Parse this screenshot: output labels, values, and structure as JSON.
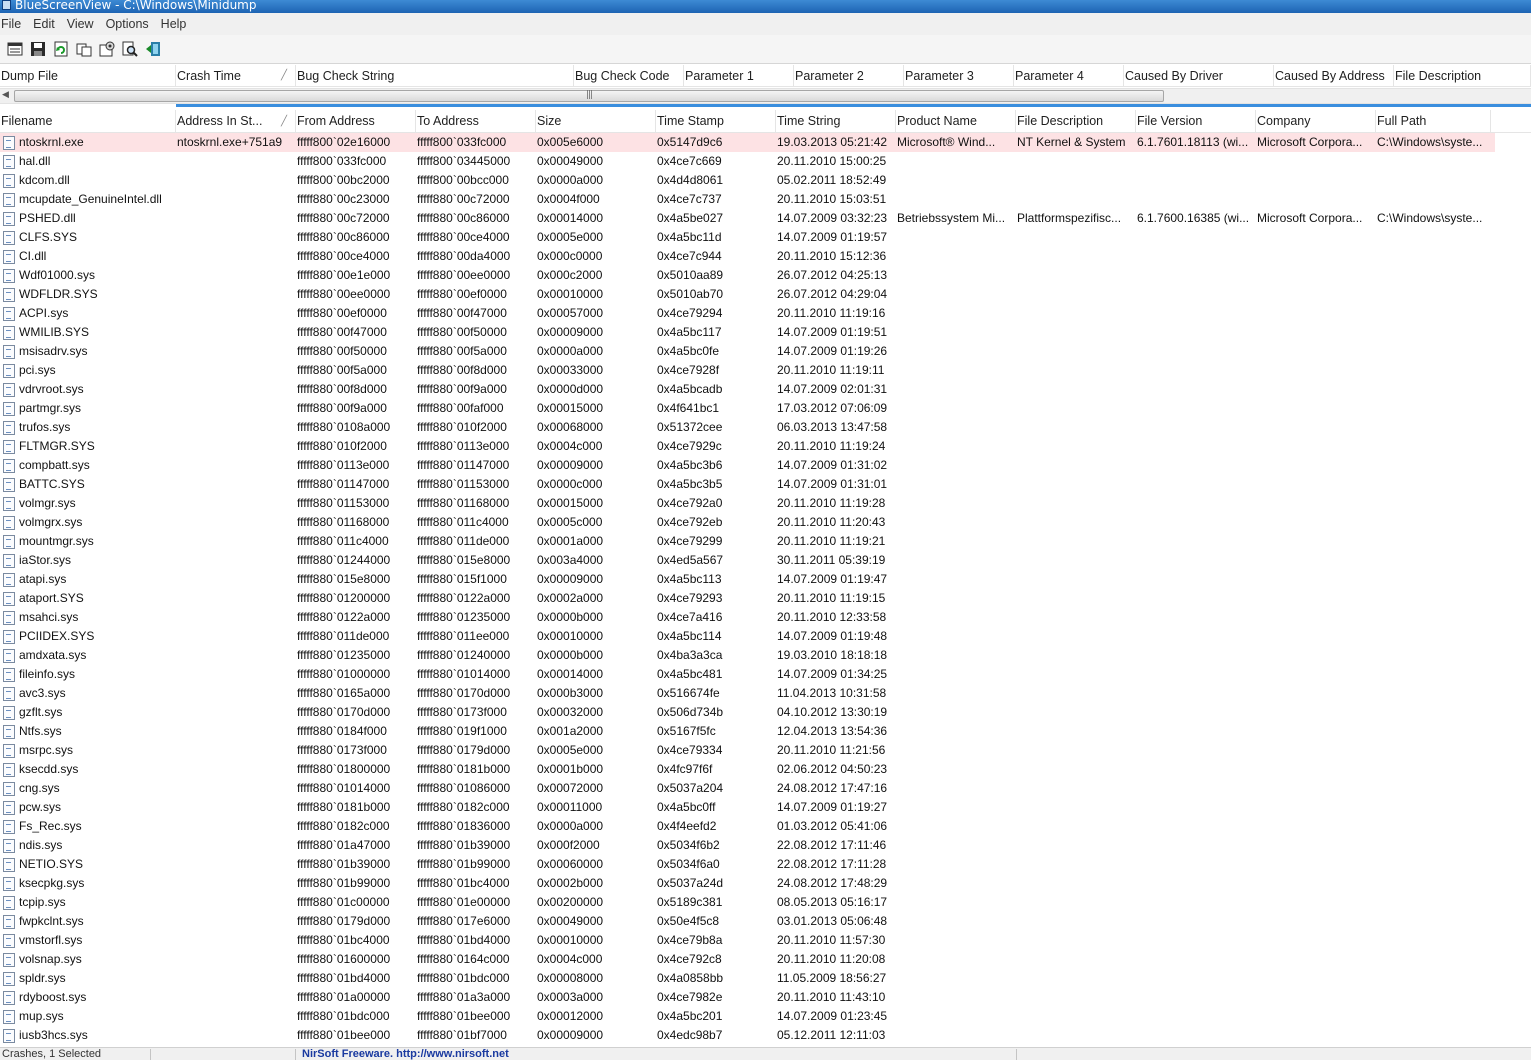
{
  "window": {
    "title": "BlueScreenView  -  C:\\Windows\\Minidump"
  },
  "menu": [
    "File",
    "Edit",
    "View",
    "Options",
    "Help"
  ],
  "toolbar": {
    "buttons": [
      "properties-icon",
      "save-icon",
      "refresh-icon",
      "copy-icon",
      "options-icon",
      "find-icon",
      "exit-icon"
    ]
  },
  "upper_table": {
    "columns": [
      "Dump File",
      "Crash Time",
      "Bug Check String",
      "Bug Check Code",
      "Parameter 1",
      "Parameter 2",
      "Parameter 3",
      "Parameter 4",
      "Caused By Driver",
      "Caused By Address",
      "File Description"
    ],
    "sorted_column": "Crash Time"
  },
  "lower_table": {
    "columns": [
      "Filename",
      "Address In St...",
      "From Address",
      "To Address",
      "Size",
      "Time Stamp",
      "Time String",
      "Product Name",
      "File Description",
      "File Version",
      "Company",
      "Full Path"
    ],
    "sorted_column": "Address In St...",
    "rows": [
      [
        "ntoskrnl.exe",
        "ntoskrnl.exe+751a9",
        "fffff800`02e16000",
        "fffff800`033fc000",
        "0x005e6000",
        "0x5147d9c6",
        "19.03.2013 05:21:42",
        "Microsoft® Wind...",
        "NT Kernel & System",
        "6.1.7601.18113 (wi...",
        "Microsoft Corpora...",
        "C:\\Windows\\syste..."
      ],
      [
        "hal.dll",
        "",
        "fffff800`033fc000",
        "fffff800`03445000",
        "0x00049000",
        "0x4ce7c669",
        "20.11.2010 15:00:25",
        "",
        "",
        "",
        "",
        ""
      ],
      [
        "kdcom.dll",
        "",
        "fffff800`00bc2000",
        "fffff800`00bcc000",
        "0x0000a000",
        "0x4d4d8061",
        "05.02.2011 18:52:49",
        "",
        "",
        "",
        "",
        ""
      ],
      [
        "mcupdate_GenuineIntel.dll",
        "",
        "fffff880`00c23000",
        "fffff880`00c72000",
        "0x0004f000",
        "0x4ce7c737",
        "20.11.2010 15:03:51",
        "",
        "",
        "",
        "",
        ""
      ],
      [
        "PSHED.dll",
        "",
        "fffff880`00c72000",
        "fffff880`00c86000",
        "0x00014000",
        "0x4a5be027",
        "14.07.2009 03:32:23",
        "Betriebssystem Mi...",
        "Plattformspezifisc...",
        "6.1.7600.16385 (wi...",
        "Microsoft Corpora...",
        "C:\\Windows\\syste..."
      ],
      [
        "CLFS.SYS",
        "",
        "fffff880`00c86000",
        "fffff880`00ce4000",
        "0x0005e000",
        "0x4a5bc11d",
        "14.07.2009 01:19:57",
        "",
        "",
        "",
        "",
        ""
      ],
      [
        "CI.dll",
        "",
        "fffff880`00ce4000",
        "fffff880`00da4000",
        "0x000c0000",
        "0x4ce7c944",
        "20.11.2010 15:12:36",
        "",
        "",
        "",
        "",
        ""
      ],
      [
        "Wdf01000.sys",
        "",
        "fffff880`00e1e000",
        "fffff880`00ee0000",
        "0x000c2000",
        "0x5010aa89",
        "26.07.2012 04:25:13",
        "",
        "",
        "",
        "",
        ""
      ],
      [
        "WDFLDR.SYS",
        "",
        "fffff880`00ee0000",
        "fffff880`00ef0000",
        "0x00010000",
        "0x5010ab70",
        "26.07.2012 04:29:04",
        "",
        "",
        "",
        "",
        ""
      ],
      [
        "ACPI.sys",
        "",
        "fffff880`00ef0000",
        "fffff880`00f47000",
        "0x00057000",
        "0x4ce79294",
        "20.11.2010 11:19:16",
        "",
        "",
        "",
        "",
        ""
      ],
      [
        "WMILIB.SYS",
        "",
        "fffff880`00f47000",
        "fffff880`00f50000",
        "0x00009000",
        "0x4a5bc117",
        "14.07.2009 01:19:51",
        "",
        "",
        "",
        "",
        ""
      ],
      [
        "msisadrv.sys",
        "",
        "fffff880`00f50000",
        "fffff880`00f5a000",
        "0x0000a000",
        "0x4a5bc0fe",
        "14.07.2009 01:19:26",
        "",
        "",
        "",
        "",
        ""
      ],
      [
        "pci.sys",
        "",
        "fffff880`00f5a000",
        "fffff880`00f8d000",
        "0x00033000",
        "0x4ce7928f",
        "20.11.2010 11:19:11",
        "",
        "",
        "",
        "",
        ""
      ],
      [
        "vdrvroot.sys",
        "",
        "fffff880`00f8d000",
        "fffff880`00f9a000",
        "0x0000d000",
        "0x4a5bcadb",
        "14.07.2009 02:01:31",
        "",
        "",
        "",
        "",
        ""
      ],
      [
        "partmgr.sys",
        "",
        "fffff880`00f9a000",
        "fffff880`00faf000",
        "0x00015000",
        "0x4f641bc1",
        "17.03.2012 07:06:09",
        "",
        "",
        "",
        "",
        ""
      ],
      [
        "trufos.sys",
        "",
        "fffff880`0108a000",
        "fffff880`010f2000",
        "0x00068000",
        "0x51372cee",
        "06.03.2013 13:47:58",
        "",
        "",
        "",
        "",
        ""
      ],
      [
        "FLTMGR.SYS",
        "",
        "fffff880`010f2000",
        "fffff880`0113e000",
        "0x0004c000",
        "0x4ce7929c",
        "20.11.2010 11:19:24",
        "",
        "",
        "",
        "",
        ""
      ],
      [
        "compbatt.sys",
        "",
        "fffff880`0113e000",
        "fffff880`01147000",
        "0x00009000",
        "0x4a5bc3b6",
        "14.07.2009 01:31:02",
        "",
        "",
        "",
        "",
        ""
      ],
      [
        "BATTC.SYS",
        "",
        "fffff880`01147000",
        "fffff880`01153000",
        "0x0000c000",
        "0x4a5bc3b5",
        "14.07.2009 01:31:01",
        "",
        "",
        "",
        "",
        ""
      ],
      [
        "volmgr.sys",
        "",
        "fffff880`01153000",
        "fffff880`01168000",
        "0x00015000",
        "0x4ce792a0",
        "20.11.2010 11:19:28",
        "",
        "",
        "",
        "",
        ""
      ],
      [
        "volmgrx.sys",
        "",
        "fffff880`01168000",
        "fffff880`011c4000",
        "0x0005c000",
        "0x4ce792eb",
        "20.11.2010 11:20:43",
        "",
        "",
        "",
        "",
        ""
      ],
      [
        "mountmgr.sys",
        "",
        "fffff880`011c4000",
        "fffff880`011de000",
        "0x0001a000",
        "0x4ce79299",
        "20.11.2010 11:19:21",
        "",
        "",
        "",
        "",
        ""
      ],
      [
        "iaStor.sys",
        "",
        "fffff880`01244000",
        "fffff880`015e8000",
        "0x003a4000",
        "0x4ed5a567",
        "30.11.2011 05:39:19",
        "",
        "",
        "",
        "",
        ""
      ],
      [
        "atapi.sys",
        "",
        "fffff880`015e8000",
        "fffff880`015f1000",
        "0x00009000",
        "0x4a5bc113",
        "14.07.2009 01:19:47",
        "",
        "",
        "",
        "",
        ""
      ],
      [
        "ataport.SYS",
        "",
        "fffff880`01200000",
        "fffff880`0122a000",
        "0x0002a000",
        "0x4ce79293",
        "20.11.2010 11:19:15",
        "",
        "",
        "",
        "",
        ""
      ],
      [
        "msahci.sys",
        "",
        "fffff880`0122a000",
        "fffff880`01235000",
        "0x0000b000",
        "0x4ce7a416",
        "20.11.2010 12:33:58",
        "",
        "",
        "",
        "",
        ""
      ],
      [
        "PCIIDEX.SYS",
        "",
        "fffff880`011de000",
        "fffff880`011ee000",
        "0x00010000",
        "0x4a5bc114",
        "14.07.2009 01:19:48",
        "",
        "",
        "",
        "",
        ""
      ],
      [
        "amdxata.sys",
        "",
        "fffff880`01235000",
        "fffff880`01240000",
        "0x0000b000",
        "0x4ba3a3ca",
        "19.03.2010 18:18:18",
        "",
        "",
        "",
        "",
        ""
      ],
      [
        "fileinfo.sys",
        "",
        "fffff880`01000000",
        "fffff880`01014000",
        "0x00014000",
        "0x4a5bc481",
        "14.07.2009 01:34:25",
        "",
        "",
        "",
        "",
        ""
      ],
      [
        "avc3.sys",
        "",
        "fffff880`0165a000",
        "fffff880`0170d000",
        "0x000b3000",
        "0x516674fe",
        "11.04.2013 10:31:58",
        "",
        "",
        "",
        "",
        ""
      ],
      [
        "gzflt.sys",
        "",
        "fffff880`0170d000",
        "fffff880`0173f000",
        "0x00032000",
        "0x506d734b",
        "04.10.2012 13:30:19",
        "",
        "",
        "",
        "",
        ""
      ],
      [
        "Ntfs.sys",
        "",
        "fffff880`0184f000",
        "fffff880`019f1000",
        "0x001a2000",
        "0x5167f5fc",
        "12.04.2013 13:54:36",
        "",
        "",
        "",
        "",
        ""
      ],
      [
        "msrpc.sys",
        "",
        "fffff880`0173f000",
        "fffff880`0179d000",
        "0x0005e000",
        "0x4ce79334",
        "20.11.2010 11:21:56",
        "",
        "",
        "",
        "",
        ""
      ],
      [
        "ksecdd.sys",
        "",
        "fffff880`01800000",
        "fffff880`0181b000",
        "0x0001b000",
        "0x4fc97f6f",
        "02.06.2012 04:50:23",
        "",
        "",
        "",
        "",
        ""
      ],
      [
        "cng.sys",
        "",
        "fffff880`01014000",
        "fffff880`01086000",
        "0x00072000",
        "0x5037a204",
        "24.08.2012 17:47:16",
        "",
        "",
        "",
        "",
        ""
      ],
      [
        "pcw.sys",
        "",
        "fffff880`0181b000",
        "fffff880`0182c000",
        "0x00011000",
        "0x4a5bc0ff",
        "14.07.2009 01:19:27",
        "",
        "",
        "",
        "",
        ""
      ],
      [
        "Fs_Rec.sys",
        "",
        "fffff880`0182c000",
        "fffff880`01836000",
        "0x0000a000",
        "0x4f4eefd2",
        "01.03.2012 05:41:06",
        "",
        "",
        "",
        "",
        ""
      ],
      [
        "ndis.sys",
        "",
        "fffff880`01a47000",
        "fffff880`01b39000",
        "0x000f2000",
        "0x5034f6b2",
        "22.08.2012 17:11:46",
        "",
        "",
        "",
        "",
        ""
      ],
      [
        "NETIO.SYS",
        "",
        "fffff880`01b39000",
        "fffff880`01b99000",
        "0x00060000",
        "0x5034f6a0",
        "22.08.2012 17:11:28",
        "",
        "",
        "",
        "",
        ""
      ],
      [
        "ksecpkg.sys",
        "",
        "fffff880`01b99000",
        "fffff880`01bc4000",
        "0x0002b000",
        "0x5037a24d",
        "24.08.2012 17:48:29",
        "",
        "",
        "",
        "",
        ""
      ],
      [
        "tcpip.sys",
        "",
        "fffff880`01c00000",
        "fffff880`01e00000",
        "0x00200000",
        "0x5189c381",
        "08.05.2013 05:16:17",
        "",
        "",
        "",
        "",
        ""
      ],
      [
        "fwpkclnt.sys",
        "",
        "fffff880`0179d000",
        "fffff880`017e6000",
        "0x00049000",
        "0x50e4f5c8",
        "03.01.2013 05:06:48",
        "",
        "",
        "",
        "",
        ""
      ],
      [
        "vmstorfl.sys",
        "",
        "fffff880`01bc4000",
        "fffff880`01bd4000",
        "0x00010000",
        "0x4ce79b8a",
        "20.11.2010 11:57:30",
        "",
        "",
        "",
        "",
        ""
      ],
      [
        "volsnap.sys",
        "",
        "fffff880`01600000",
        "fffff880`0164c000",
        "0x0004c000",
        "0x4ce792c8",
        "20.11.2010 11:20:08",
        "",
        "",
        "",
        "",
        ""
      ],
      [
        "spldr.sys",
        "",
        "fffff880`01bd4000",
        "fffff880`01bdc000",
        "0x00008000",
        "0x4a0858bb",
        "11.05.2009 18:56:27",
        "",
        "",
        "",
        "",
        ""
      ],
      [
        "rdyboost.sys",
        "",
        "fffff880`01a00000",
        "fffff880`01a3a000",
        "0x0003a000",
        "0x4ce7982e",
        "20.11.2010 11:43:10",
        "",
        "",
        "",
        "",
        ""
      ],
      [
        "mup.sys",
        "",
        "fffff880`01bdc000",
        "fffff880`01bee000",
        "0x00012000",
        "0x4a5bc201",
        "14.07.2009 01:23:45",
        "",
        "",
        "",
        "",
        ""
      ],
      [
        "iusb3hcs.sys",
        "",
        "fffff880`01bee000",
        "fffff880`01bf7000",
        "0x00009000",
        "0x4edc98b7",
        "05.12.2011 12:11:03",
        "",
        "",
        "",
        "",
        ""
      ]
    ]
  },
  "status": {
    "left": "Crashes, 1 Selected",
    "link": "NirSoft Freeware.  http://www.nirsoft.net"
  },
  "colors": {
    "highlight_row": "#fde2e4",
    "splitter": "#3a8ede",
    "title_bar": "#1d63b3"
  }
}
